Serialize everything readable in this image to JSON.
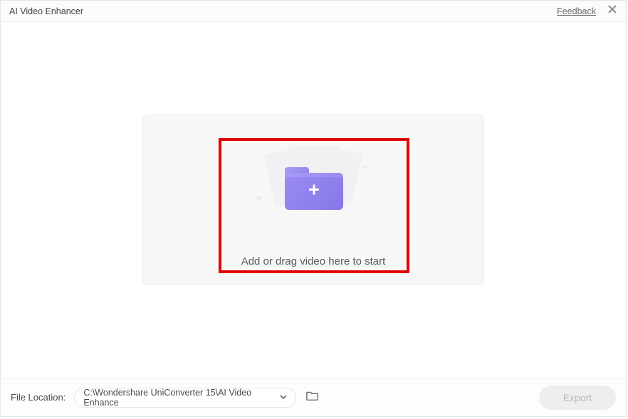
{
  "titlebar": {
    "title": "AI Video Enhancer",
    "feedback_label": "Feedback"
  },
  "dropzone": {
    "instruction": "Add or drag video here to start"
  },
  "footer": {
    "file_location_label": "File Location:",
    "path_value": "C:\\Wondershare UniConverter 15\\AI Video Enhance",
    "export_label": "Export"
  },
  "icons": {
    "close": "close-icon",
    "folder_plus": "plus-icon",
    "caret_down": "chevron-down-icon",
    "browse_folder": "folder-outline-icon"
  },
  "colors": {
    "highlight_border": "#e30000",
    "folder_gradient_start": "#a79bf5",
    "folder_gradient_end": "#8677e9",
    "export_disabled_bg": "#eeeef0",
    "export_disabled_fg": "#b9b9bd"
  }
}
